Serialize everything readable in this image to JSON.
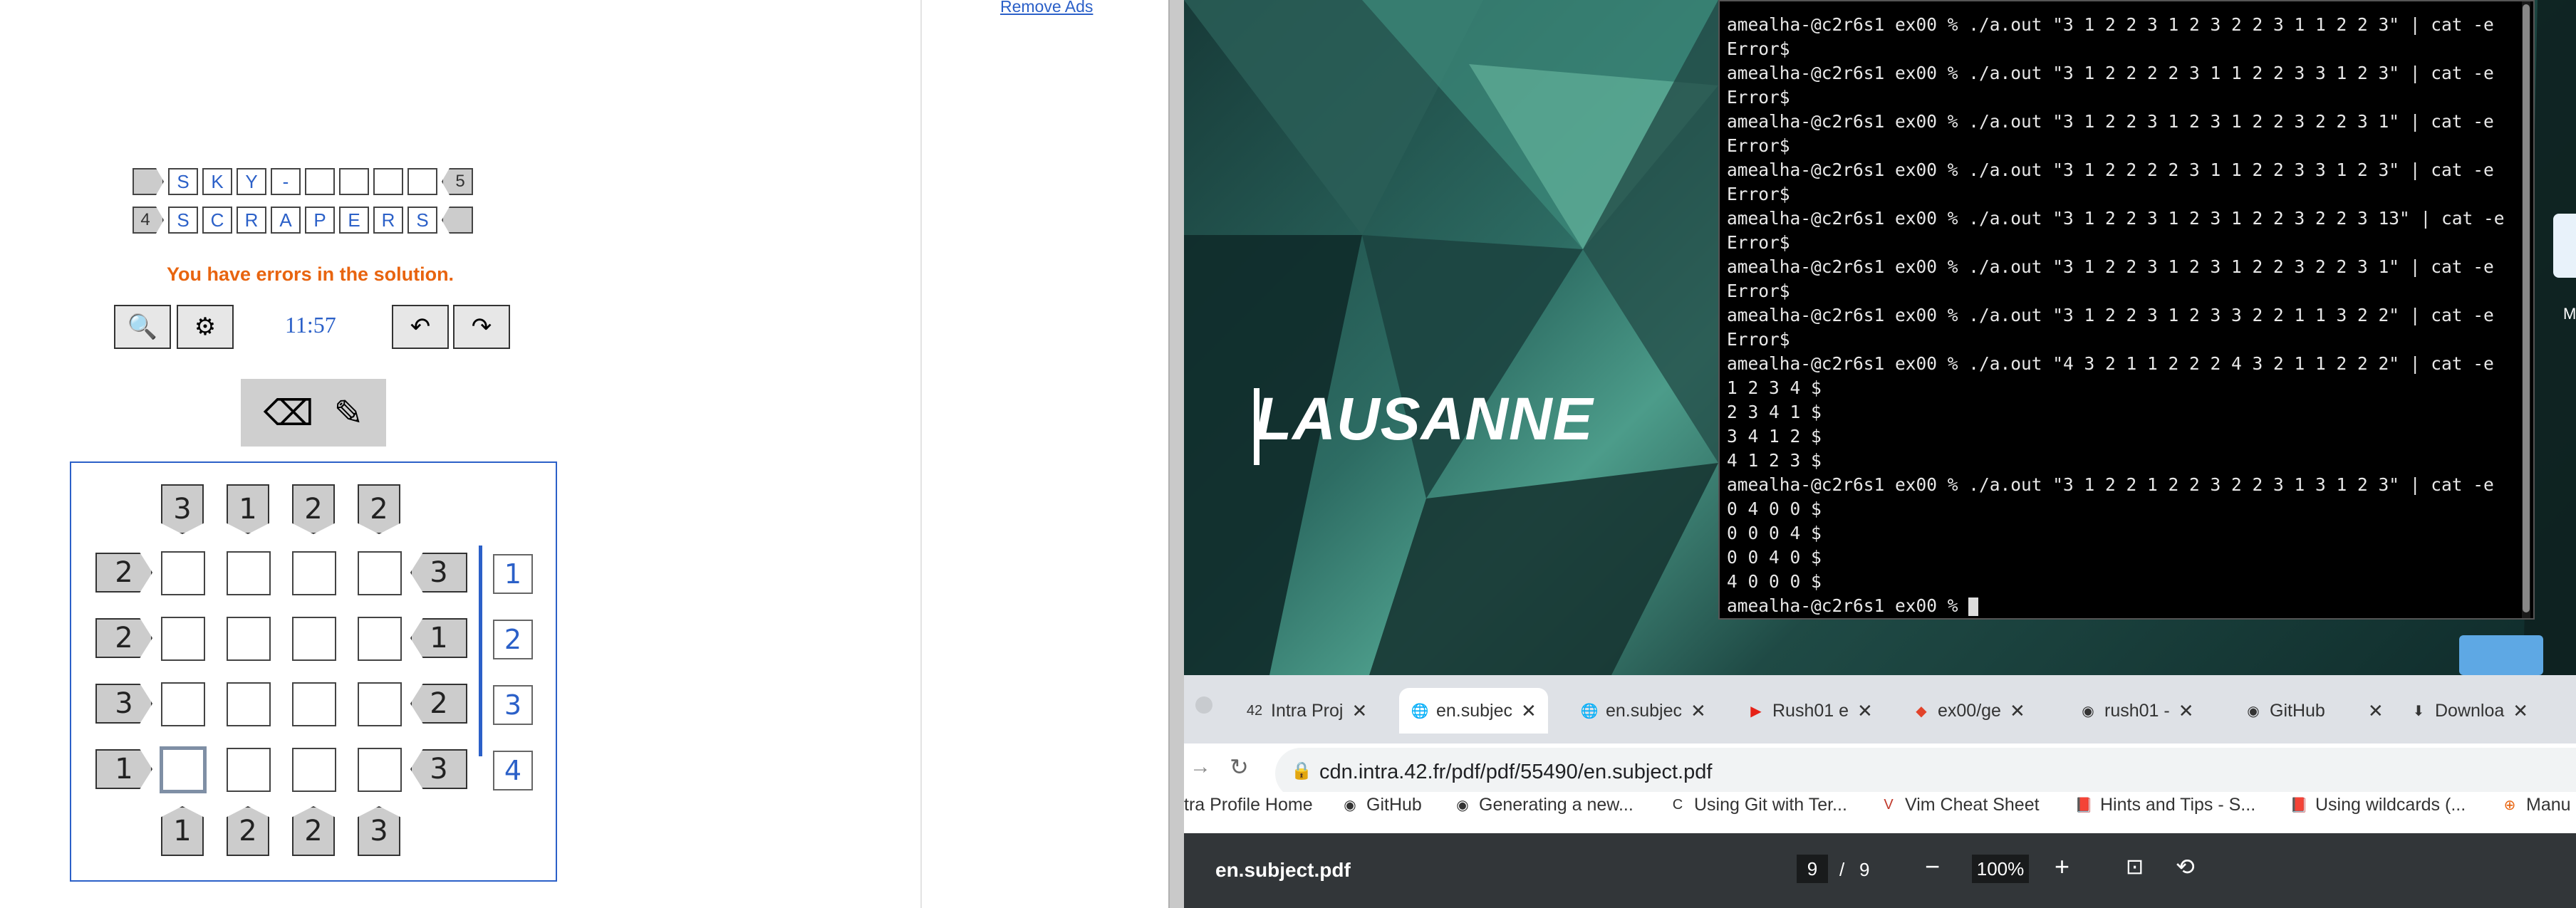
{
  "puzzle": {
    "title_row1": [
      "S",
      "K",
      "Y",
      "-",
      "",
      "",
      "",
      "",
      ""
    ],
    "title_row1_tag": "5",
    "title_row2": [
      "S",
      "C",
      "R",
      "A",
      "P",
      "E",
      "R",
      "S"
    ],
    "title_row2_tag": "4",
    "error_message": "You have errors in the solution.",
    "timer": "11:57",
    "top_clues": [
      "3",
      "1",
      "2",
      "2"
    ],
    "bottom_clues": [
      "1",
      "2",
      "2",
      "3"
    ],
    "left_clues": [
      "2",
      "2",
      "3",
      "1"
    ],
    "right_clues": [
      "3",
      "1",
      "2",
      "3"
    ],
    "hints": [
      "1",
      "2",
      "3",
      "4"
    ],
    "icons": {
      "zoom": "magnify-plus-icon",
      "settings": "gear-icon",
      "undo": "undo-icon",
      "redo": "redo-icon",
      "eraser": "eraser-icon",
      "pencil": "pencil-icon"
    }
  },
  "ad": {
    "remove_ads": "Remove Ads"
  },
  "desktop": {
    "wallpaper_text": "LAUSANNE",
    "side_label": "M"
  },
  "terminal": {
    "lines": [
      "amealha-@c2r6s1 ex00 % ./a.out \"3 1 2 2 3 1 2 3 2 2 3 1 1 2 2 3\" | cat -e",
      "Error$",
      "amealha-@c2r6s1 ex00 % ./a.out \"3 1 2 2 2 2 3 1 1 2 2 3 3 1 2 3\" | cat -e",
      "Error$",
      "amealha-@c2r6s1 ex00 % ./a.out \"3 1 2 2 3 1 2 3 1 2 2 3 2 2 3 1\" | cat -e",
      "Error$",
      "amealha-@c2r6s1 ex00 % ./a.out \"3 1 2 2 2 2 3 1 1 2 2 3 3 1 2 3\" | cat -e",
      "Error$",
      "amealha-@c2r6s1 ex00 % ./a.out \"3 1 2 2 3 1 2 3 1 2 2 3 2 2 3 13\" | cat -e",
      "Error$",
      "amealha-@c2r6s1 ex00 % ./a.out \"3 1 2 2 3 1 2 3 1 2 2 3 2 2 3 1\" | cat -e",
      "Error$",
      "amealha-@c2r6s1 ex00 % ./a.out \"3 1 2 2 3 1 2 3 3 2 2 1 1 3 2 2\" | cat -e",
      "Error$",
      "amealha-@c2r6s1 ex00 % ./a.out \"4 3 2 1 1 2 2 2 4 3 2 1 1 2 2 2\" | cat -e",
      "1 2 3 4 $",
      "2 3 4 1 $",
      "3 4 1 2 $",
      "4 1 2 3 $",
      "amealha-@c2r6s1 ex00 % ./a.out \"3 1 2 2 1 2 2 3 2 2 3 1 3 1 2 3\" | cat -e",
      "0 4 0 0 $",
      "0 0 0 4 $",
      "0 0 4 0 $",
      "4 0 0 0 $",
      "amealha-@c2r6s1 ex00 % "
    ]
  },
  "browser": {
    "tabs": [
      {
        "label": "Intra Proj",
        "icon": "42-logo-icon"
      },
      {
        "label": "en.subjec",
        "icon": "globe-icon"
      },
      {
        "label": "en.subjec",
        "icon": "globe-icon"
      },
      {
        "label": "Rush01 e",
        "icon": "youtube-icon"
      },
      {
        "label": "ex00/ge",
        "icon": "gitlab-icon"
      },
      {
        "label": "rush01 -",
        "icon": "github-icon"
      },
      {
        "label": "GitHub",
        "icon": "github-icon"
      },
      {
        "label": "Downloa",
        "icon": "download-icon"
      }
    ],
    "url": "cdn.intra.42.fr/pdf/pdf/55490/en.subject.pdf",
    "bookmarks": [
      {
        "label": "tra Profile Home",
        "icon": ""
      },
      {
        "label": "GitHub",
        "icon": "github-icon"
      },
      {
        "label": "Generating a new...",
        "icon": "github-icon"
      },
      {
        "label": "Using Git with Ter...",
        "icon": "c-logo-icon"
      },
      {
        "label": "Vim Cheat Sheet",
        "icon": "vim-icon"
      },
      {
        "label": "Hints and Tips - S...",
        "icon": "book-icon"
      },
      {
        "label": "Using wildcards (...",
        "icon": "book-icon"
      },
      {
        "label": "Manu",
        "icon": "plus-circle-icon"
      }
    ],
    "pdf": {
      "filename": "en.subject.pdf",
      "page": "9",
      "separator": "/",
      "total": "9",
      "zoom": "100%"
    }
  },
  "colors": {
    "accent": "#2b60c8",
    "error": "#e8640f",
    "terminal_bg": "#000000",
    "pdf_bar": "#323639"
  }
}
